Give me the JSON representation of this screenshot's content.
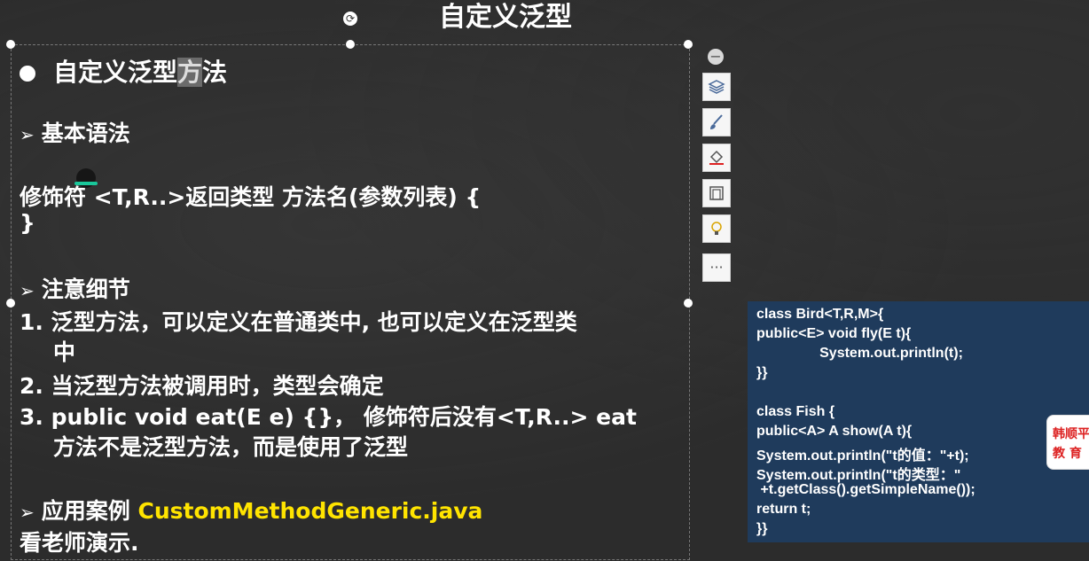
{
  "slide": {
    "title": "自定义泛型",
    "heading": "自定义泛型方法",
    "heading_prefix": "自定义泛型",
    "heading_highlight": "方",
    "heading_suffix": "法",
    "section_syntax": "基本语法",
    "syntax_line1": "修饰符 <T,R..>返回类型 方法名(参数列表) {",
    "syntax_line2": "}",
    "section_notes": "注意细节",
    "notes": [
      "1. 泛型方法，可以定义在普通类中, 也可以定义在泛型类",
      "中",
      "2. 当泛型方法被调用时，类型会确定",
      "3. public void eat(E e) {}， 修饰符后没有<T,R..> eat",
      "方法不是泛型方法，而是使用了泛型"
    ],
    "section_case": "应用案例 ",
    "case_file": "CustomMethodGeneric.java",
    "demo_text": "看老师演示."
  },
  "code_panel": {
    "lines": [
      "class Bird<T,R,M>{",
      "public<E> void fly(E t){",
      "                System.out.println(t);",
      "}}",
      "",
      "class Fish {",
      "public<A> A show(A t){",
      "System.out.println(\"t的值：\"+t);",
      "System.out.println(\"t的类型：\"",
      " +t.getClass().getSimpleName());",
      "return t;",
      "}}"
    ]
  },
  "toolbar": {
    "collapse_icon": "−",
    "more_label": "···"
  },
  "watermark": {
    "line1": "韩顺平",
    "line2": "教  育"
  },
  "colors": {
    "accent_yellow": "#ffe400",
    "code_bg": "#1f3b5c"
  }
}
